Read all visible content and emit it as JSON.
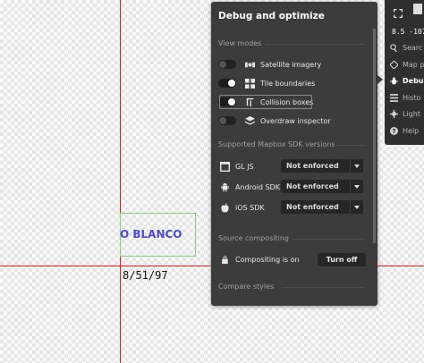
{
  "map": {
    "label": "O BLANCO",
    "date": "8/51/97"
  },
  "debug_panel": {
    "title": "Debug and optimize",
    "sections": {
      "view_modes": "View modes",
      "sdk": "Supported Mapbox SDK versions",
      "compositing": "Source compositing",
      "compare": "Compare styles"
    },
    "view_modes": [
      {
        "label": "Satellite imagery",
        "on": false,
        "icon": "satellite-icon"
      },
      {
        "label": "Tile boundaries",
        "on": true,
        "icon": "grid-icon"
      },
      {
        "label": "Collision boxes",
        "on": true,
        "icon": "collision-icon"
      },
      {
        "label": "Overdraw inspector",
        "on": false,
        "icon": "layers-icon"
      }
    ],
    "sdk_rows": [
      {
        "label": "GL JS",
        "value": "Not enforced",
        "icon": "browser-icon"
      },
      {
        "label": "Android SDK",
        "value": "Not enforced",
        "icon": "android-icon"
      },
      {
        "label": "iOS SDK",
        "value": "Not enforced",
        "icon": "apple-icon"
      }
    ],
    "compositing_status": "Compositing is on",
    "compositing_button": "Turn off"
  },
  "side_panel": {
    "coords": "8.5 -107",
    "items": [
      {
        "label": "Searc",
        "icon": "search-icon",
        "active": false
      },
      {
        "label": "Map p",
        "icon": "map-position-icon",
        "active": false
      },
      {
        "label": "Debu",
        "icon": "bug-icon",
        "active": true
      },
      {
        "label": "Histo",
        "icon": "history-icon",
        "active": false
      },
      {
        "label": "Light",
        "icon": "gear-icon",
        "active": false
      },
      {
        "label": "Help",
        "icon": "help-icon",
        "active": false
      }
    ]
  },
  "colors": {
    "panel_bg": "#3c3c3c",
    "guide_line": "#e02020",
    "map_label": "#4b4ad6",
    "collision_box": "#7fd07f"
  }
}
